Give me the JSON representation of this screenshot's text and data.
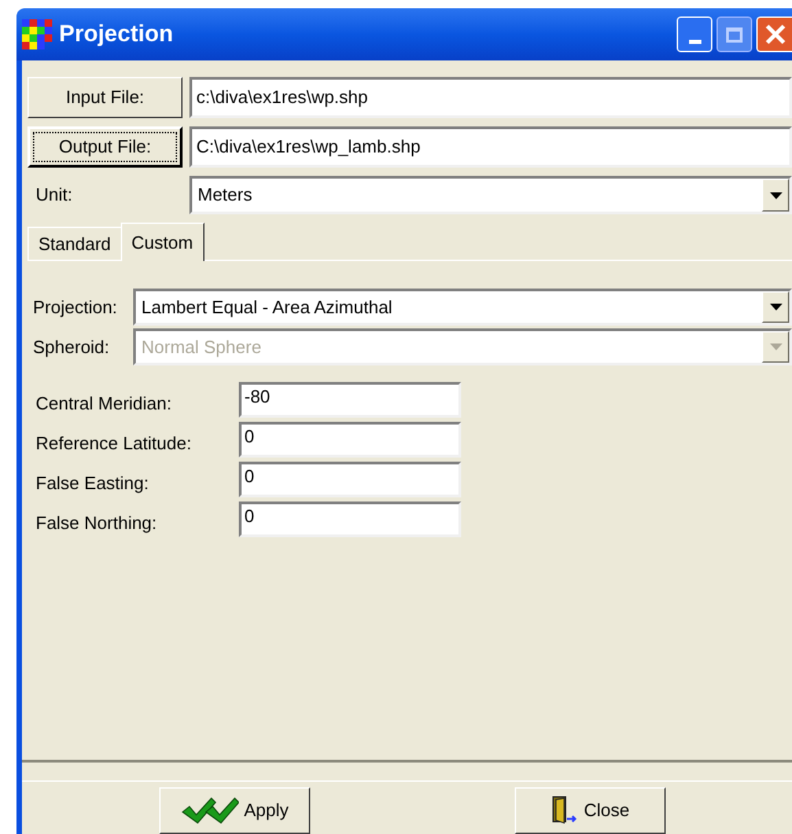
{
  "window": {
    "title": "Projection"
  },
  "files": [
    {
      "button": "Input File:",
      "value": "c:\\diva\\ex1res\\wp.shp",
      "focused": false
    },
    {
      "button": "Output File:",
      "value": "C:\\diva\\ex1res\\wp_lamb.shp",
      "focused": true
    }
  ],
  "unit": {
    "label": "Unit:",
    "value": "Meters"
  },
  "tabs": [
    {
      "label": "Standard",
      "selected": false
    },
    {
      "label": "Custom",
      "selected": true
    }
  ],
  "selects": [
    {
      "label": "Projection:",
      "value": "Lambert Equal - Area Azimuthal",
      "disabled": false
    },
    {
      "label": "Spheroid:",
      "value": "Normal Sphere",
      "disabled": true
    }
  ],
  "params": [
    {
      "label": "Central Meridian:",
      "value": "-80"
    },
    {
      "label": "Reference Latitude:",
      "value": "0"
    },
    {
      "label": "False Easting:",
      "value": "0"
    },
    {
      "label": "False Northing:",
      "value": "0"
    }
  ],
  "buttons": [
    {
      "kind": "apply",
      "label": "Apply"
    },
    {
      "kind": "close",
      "label": "Close"
    }
  ]
}
